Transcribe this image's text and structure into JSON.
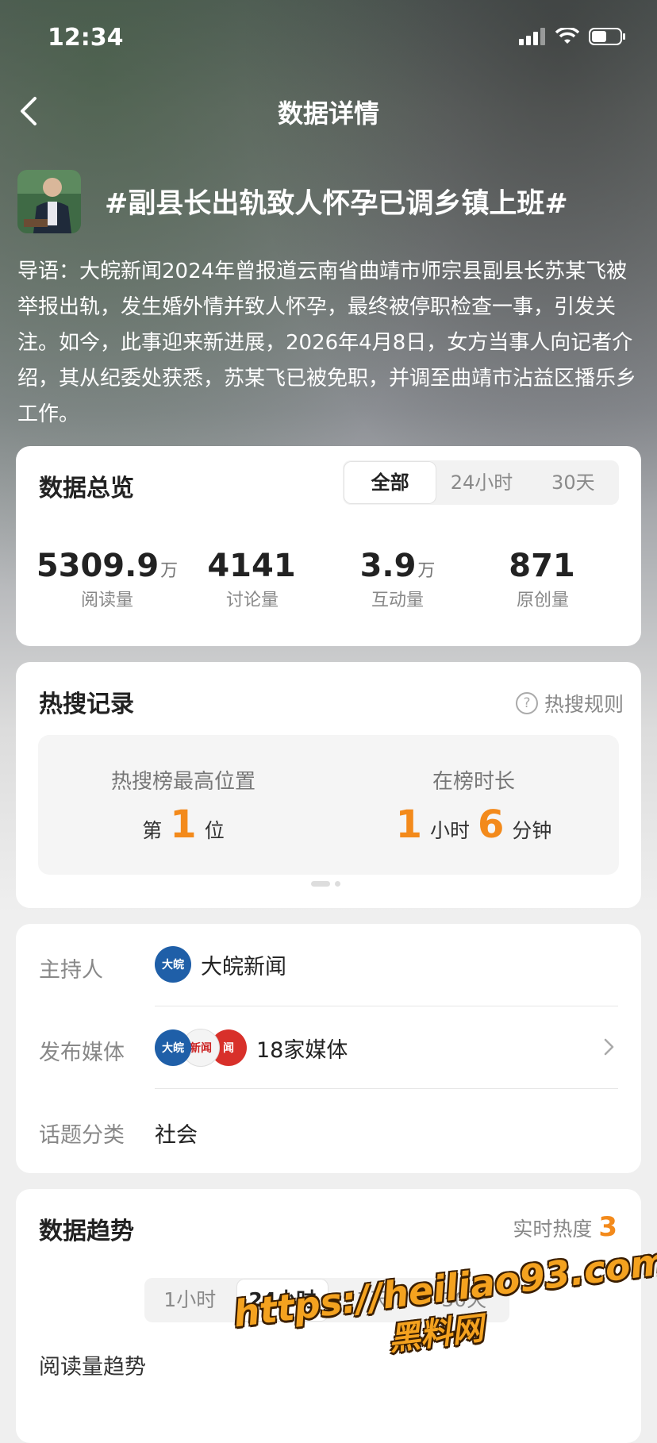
{
  "status_bar": {
    "time": "12:34"
  },
  "nav": {
    "title": "数据详情"
  },
  "topic": {
    "title": "#副县长出轨致人怀孕已调乡镇上班#",
    "intro": "导语：大皖新闻2024年曾报道云南省曲靖市师宗县副县长苏某飞被举报出轨，发生婚外情并致人怀孕，最终被停职检查一事，引发关注。如今，此事迎来新进展，2026年4月8日，女方当事人向记者介绍，其从纪委处获悉，苏某飞已被免职，并调至曲靖市沾益区播乐乡工作。"
  },
  "overview": {
    "title": "数据总览",
    "tabs": [
      "全部",
      "24小时",
      "30天"
    ],
    "active_tab": "全部",
    "stats": [
      {
        "value": "5309.9",
        "unit": "万",
        "label": "阅读量"
      },
      {
        "value": "4141",
        "unit": "",
        "label": "讨论量"
      },
      {
        "value": "3.9",
        "unit": "万",
        "label": "互动量"
      },
      {
        "value": "871",
        "unit": "",
        "label": "原创量"
      }
    ]
  },
  "hot_search": {
    "title": "热搜记录",
    "rules_label": "热搜规则",
    "rank_caption": "热搜榜最高位置",
    "rank_prefix": "第",
    "rank_value": "1",
    "rank_suffix": "位",
    "duration_caption": "在榜时长",
    "hours": "1",
    "hours_unit": "小时",
    "minutes": "6",
    "minutes_unit": "分钟"
  },
  "info": {
    "host_label": "主持人",
    "host_name": "大皖新闻",
    "media_label": "发布媒体",
    "media_count": "18家媒体",
    "category_label": "话题分类",
    "category": "社会",
    "logos": {
      "dawan": "大皖",
      "media2": "新闻",
      "media3": "闻"
    }
  },
  "trend": {
    "title": "数据趋势",
    "realtime_label": "实时热度",
    "realtime_value": "3",
    "tabs": [
      "1小时",
      "24小时",
      "7天",
      "30天"
    ],
    "active_tab": "24小时",
    "chart_label": "阅读量趋势"
  },
  "watermark": {
    "url": "https://heiliao93.com",
    "name": "黑料网"
  },
  "colors": {
    "accent": "#f38a1b",
    "card": "#ffffff",
    "page_bg": "#efefef"
  }
}
